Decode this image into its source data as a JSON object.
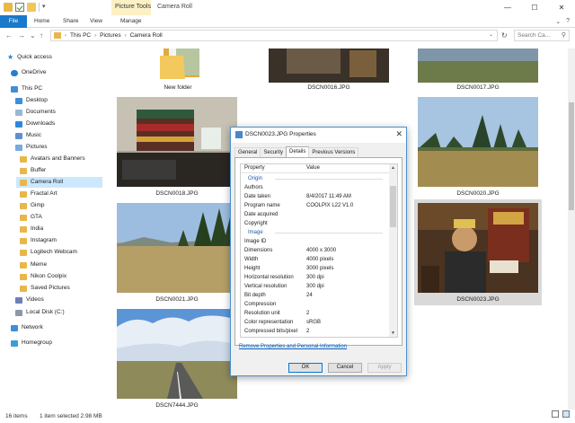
{
  "window": {
    "title": "Camera Roll",
    "context_tab_group": "Picture Tools",
    "controls": {
      "minimize": "—",
      "maximize": "☐",
      "close": "✕"
    }
  },
  "ribbon": {
    "tabs": [
      "File",
      "Home",
      "Share",
      "View",
      "Manage"
    ],
    "expand_icon": "⌄",
    "help_icon": "?"
  },
  "address": {
    "back": "←",
    "forward": "→",
    "recent": "⌄",
    "up": "↑",
    "path": [
      "This PC",
      "Pictures",
      "Camera Roll"
    ],
    "refresh": "↻",
    "search_placeholder": "Search Ca...",
    "search_icon": "⚲"
  },
  "nav": {
    "items": [
      {
        "label": "Quick access",
        "icon": "quick-access-star-icon"
      },
      {
        "label": "OneDrive",
        "icon": "onedrive-icon"
      },
      {
        "label": "This PC",
        "icon": "this-pc-icon"
      },
      {
        "label": "Desktop",
        "icon": "desktop-folder-icon"
      },
      {
        "label": "Documents",
        "icon": "documents-icon"
      },
      {
        "label": "Downloads",
        "icon": "downloads-icon"
      },
      {
        "label": "Music",
        "icon": "music-icon"
      },
      {
        "label": "Pictures",
        "icon": "pictures-icon"
      },
      {
        "label": "Avatars and Banners",
        "icon": "folder-icon"
      },
      {
        "label": "Buffer",
        "icon": "folder-icon"
      },
      {
        "label": "Camera Roll",
        "icon": "folder-icon"
      },
      {
        "label": "Fractal Art",
        "icon": "folder-icon"
      },
      {
        "label": "Gimp",
        "icon": "folder-icon"
      },
      {
        "label": "GTA",
        "icon": "folder-icon"
      },
      {
        "label": "India",
        "icon": "folder-icon"
      },
      {
        "label": "Instagram",
        "icon": "folder-icon"
      },
      {
        "label": "Logitech Webcam",
        "icon": "folder-icon"
      },
      {
        "label": "Meme",
        "icon": "folder-icon"
      },
      {
        "label": "Nikon Coolpix",
        "icon": "folder-icon"
      },
      {
        "label": "Saved Pictures",
        "icon": "folder-icon"
      },
      {
        "label": "Videos",
        "icon": "videos-icon"
      },
      {
        "label": "Local Disk (C:)",
        "icon": "local-disk-icon"
      },
      {
        "label": "Network",
        "icon": "network-icon"
      },
      {
        "label": "Homegroup",
        "icon": "homegroup-icon"
      }
    ],
    "selected": "Camera Roll"
  },
  "files": [
    {
      "name": "New folder",
      "kind": "folder"
    },
    {
      "name": "DSCN0016.JPG",
      "kind": "image"
    },
    {
      "name": "DSCN0017.JPG",
      "kind": "image"
    },
    {
      "name": "DSCN0018.JPG",
      "kind": "image"
    },
    {
      "name": "DSCN0020.JPG",
      "kind": "image"
    },
    {
      "name": "DSCN0021.JPG",
      "kind": "image"
    },
    {
      "name": "DSCN0023.JPG",
      "kind": "image",
      "selected": true
    },
    {
      "name": "DSCN7444.JPG",
      "kind": "image"
    }
  ],
  "status": {
    "items_count": "16 items",
    "selection": "1 item selected  2.98 MB"
  },
  "dialog": {
    "title": "DSCN0023.JPG Properties",
    "close": "✕",
    "tabs": [
      "General",
      "Security",
      "Details",
      "Previous Versions"
    ],
    "active_tab": "Details",
    "columns": {
      "property": "Property",
      "value": "Value"
    },
    "rows": [
      {
        "section": "Origin"
      },
      {
        "name": "Authors",
        "value": ""
      },
      {
        "name": "Date taken",
        "value": "8/4/2017 11:49 AM"
      },
      {
        "name": "Program name",
        "value": "COOLPIX L22 V1.0"
      },
      {
        "name": "Date acquired",
        "value": ""
      },
      {
        "name": "Copyright",
        "value": ""
      },
      {
        "section": "Image"
      },
      {
        "name": "Image ID",
        "value": ""
      },
      {
        "name": "Dimensions",
        "value": "4000 x 3000"
      },
      {
        "name": "Width",
        "value": "4000 pixels"
      },
      {
        "name": "Height",
        "value": "3000 pixels"
      },
      {
        "name": "Horizontal resolution",
        "value": "300 dpi"
      },
      {
        "name": "Vertical resolution",
        "value": "300 dpi"
      },
      {
        "name": "Bit depth",
        "value": "24"
      },
      {
        "name": "Compression",
        "value": ""
      },
      {
        "name": "Resolution unit",
        "value": "2"
      },
      {
        "name": "Color representation",
        "value": "sRGB"
      },
      {
        "name": "Compressed bits/pixel",
        "value": "2"
      }
    ],
    "remove_link": "Remove Properties and Personal Information",
    "buttons": {
      "ok": "OK",
      "cancel": "Cancel",
      "apply": "Apply"
    }
  }
}
